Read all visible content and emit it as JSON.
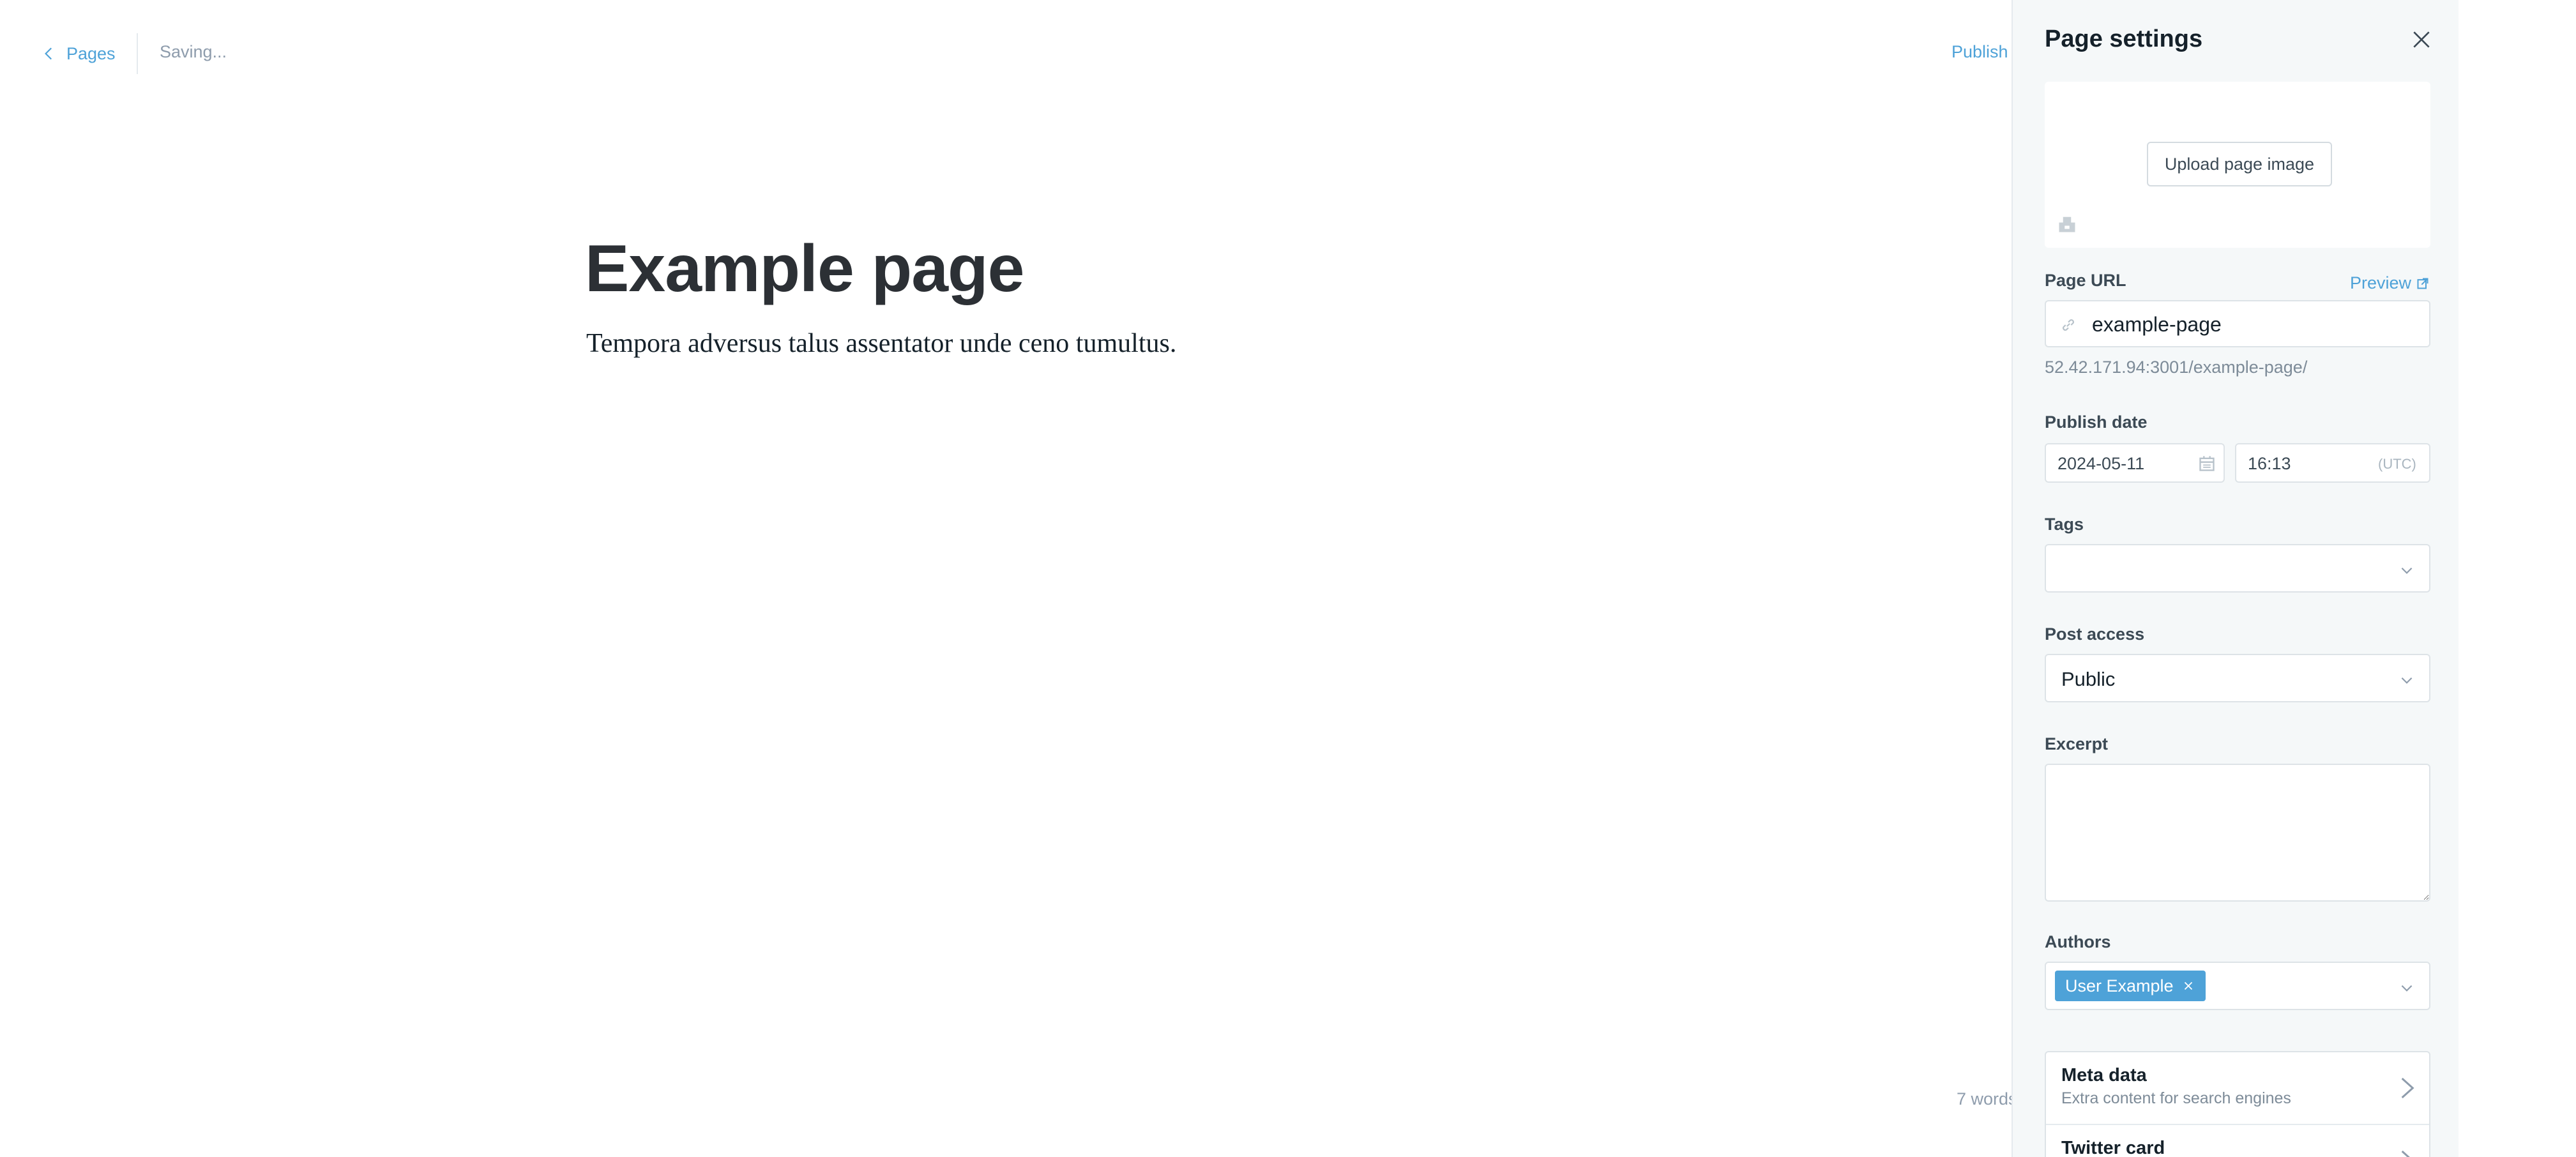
{
  "editor": {
    "back_label": "Pages",
    "status": "Saving...",
    "publish_label": "Publish",
    "title": "Example page",
    "body": "Tempora adversus talus assentator unde ceno tumultus.",
    "word_count": "7 words"
  },
  "settings": {
    "title": "Page settings",
    "upload_label": "Upload page image",
    "page_url": {
      "label": "Page URL",
      "preview_label": "Preview",
      "value": "example-page",
      "hint": "52.42.171.94:3001/example-page/"
    },
    "publish_date": {
      "label": "Publish date",
      "date": "2024-05-11",
      "time": "16:13",
      "timezone": "(UTC)"
    },
    "tags": {
      "label": "Tags",
      "value": ""
    },
    "post_access": {
      "label": "Post access",
      "value": "Public"
    },
    "excerpt": {
      "label": "Excerpt",
      "value": ""
    },
    "authors": {
      "label": "Authors",
      "items": [
        "User Example"
      ]
    },
    "nav_items": [
      {
        "title": "Meta data",
        "subtitle": "Extra content for search engines"
      },
      {
        "title": "Twitter card",
        "subtitle": ""
      }
    ]
  },
  "colors": {
    "accent": "#4ea2d8",
    "panel_bg": "#f5f8f9",
    "text": "#15212a",
    "muted": "#8e9cac"
  },
  "icons": {
    "back": "chevron-left-icon",
    "close": "close-icon",
    "image": "image-placeholder-icon",
    "link": "link-icon",
    "preview": "external-link-icon",
    "calendar": "calendar-icon",
    "dropdown": "chevron-down-icon",
    "chip_remove": "close-icon",
    "nav": "chevron-right-icon"
  }
}
